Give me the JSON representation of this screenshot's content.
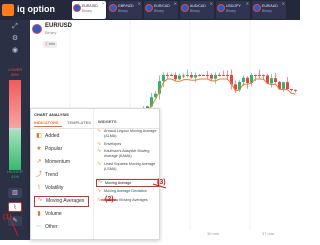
{
  "header": {
    "brand": "iq option",
    "tabs": [
      {
        "symbol": "EUR/USD",
        "type": "Binary",
        "active": true
      },
      {
        "symbol": "GBP/NZD",
        "type": "Binary",
        "active": false
      },
      {
        "symbol": "EUR/CAD",
        "type": "Binary",
        "active": false
      },
      {
        "symbol": "AUD/CAD",
        "type": "Binary",
        "active": false
      },
      {
        "symbol": "USD/JPY",
        "type": "Binary",
        "active": false
      },
      {
        "symbol": "EUR/AUD",
        "type": "Binary",
        "active": false
      }
    ]
  },
  "strip": {
    "lower_label": "LOWER",
    "lower_value": "59%",
    "higher_label": "HIGHER",
    "higher_value": "41%"
  },
  "asset": {
    "name": "EUR/USD",
    "type": "Binary",
    "info_label": "Info"
  },
  "time_labels": [
    "30 min",
    "37 min"
  ],
  "panel": {
    "title": "CHART ANALYSIS",
    "tabs": [
      "INDICATORS",
      "TEMPLATES"
    ],
    "widgets_title": "WIDGETS",
    "categories": [
      "Added",
      "Popular",
      "Momentum",
      "Trend",
      "Volatility",
      "Moving Averages",
      "Volume",
      "Other"
    ],
    "indicators": [
      "Arnaud Legoux Moving Average (ALMA)",
      "Envelopes",
      "Kaufman's Adaptive Moving Average (KAMA)",
      "Least Squares Moving Average (LSMA)",
      "Moving Average",
      "Moving Average Deviation",
      "Rainbow Moving Averages"
    ]
  },
  "annotations": [
    "(1)",
    "(2)",
    "(3)"
  ],
  "colors": {
    "topbar": "#23283b",
    "accent": "#e8732a",
    "bearish": "#e04848",
    "bullish": "#2fb36e",
    "ma_line": "#f07a32",
    "annotation": "#c41e1e"
  },
  "icons": {
    "expand": "expand-icon",
    "eye": "eye-icon",
    "indicators": "indicators-icon",
    "drawing": "pencil-icon"
  }
}
